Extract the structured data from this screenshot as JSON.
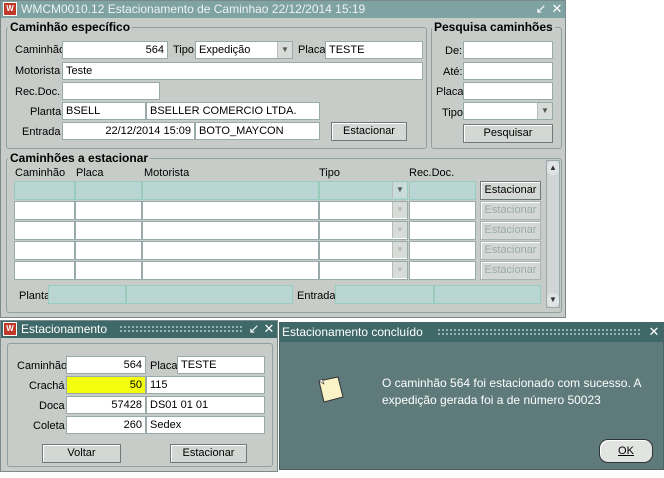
{
  "main": {
    "title": "WMCM0010.12    Estacionamento de Caminhao    22/12/2014 15:19",
    "specific": {
      "title": "Caminhão específico",
      "caminhao_label": "Caminhão",
      "caminhao": "564",
      "tipo_label": "Tipo",
      "tipo": "Expedição",
      "placa_label": "Placa",
      "placa": "TESTE",
      "motorista_label": "Motorista",
      "motorista": "Teste",
      "recdoc_label": "Rec.Doc.",
      "recdoc": "",
      "planta_label": "Planta",
      "planta_code": "BSELL",
      "planta_name": "BSELLER COMERCIO LTDA.",
      "entrada_label": "Entrada",
      "entrada_date": "22/12/2014 15:09",
      "entrada_user": "BOTO_MAYCON",
      "estacionar_button": "Estacionar"
    },
    "search": {
      "title": "Pesquisa caminhões",
      "de_label": "De:",
      "ate_label": "Até:",
      "placa_label": "Placa",
      "tipo_label": "Tipo",
      "pesquisar_button": "Pesquisar"
    },
    "list": {
      "title": "Caminhões a estacionar",
      "columns": [
        "Caminhão",
        "Placa",
        "Motorista",
        "Tipo",
        "Rec.Doc."
      ],
      "row_button": "Estacionar",
      "planta_label": "Planta",
      "entrada_label": "Entrada"
    }
  },
  "dialog_estacionamento": {
    "title": "Estacionamento",
    "caminhao_label": "Caminhão",
    "caminhao": "564",
    "placa_label": "Placa",
    "placa": "TESTE",
    "cracha_label": "Crachá",
    "cracha": "50",
    "cracha_desc": "115",
    "doca_label": "Doca",
    "doca": "57428",
    "doca_desc": "DS01 01 01",
    "coleta_label": "Coleta",
    "coleta": "260",
    "coleta_desc": "Sedex",
    "voltar_button": "Voltar",
    "estacionar_button": "Estacionar"
  },
  "dialog_concluido": {
    "title": "Estacionamento concluído",
    "message_line1": "O caminhão 564 foi estacionado com sucesso. A",
    "message_line2": "expedição gerada foi a de número 50023",
    "ok_button": "OK"
  },
  "colors": {
    "titlebar_inactive": "#7fa2a2",
    "titlebar_active": "#3f6868",
    "window_bg": "#c8ccc8",
    "teal_field": "#b9d6d4",
    "message_bg": "#5e7a7a",
    "highlight": "#f4ff10"
  }
}
